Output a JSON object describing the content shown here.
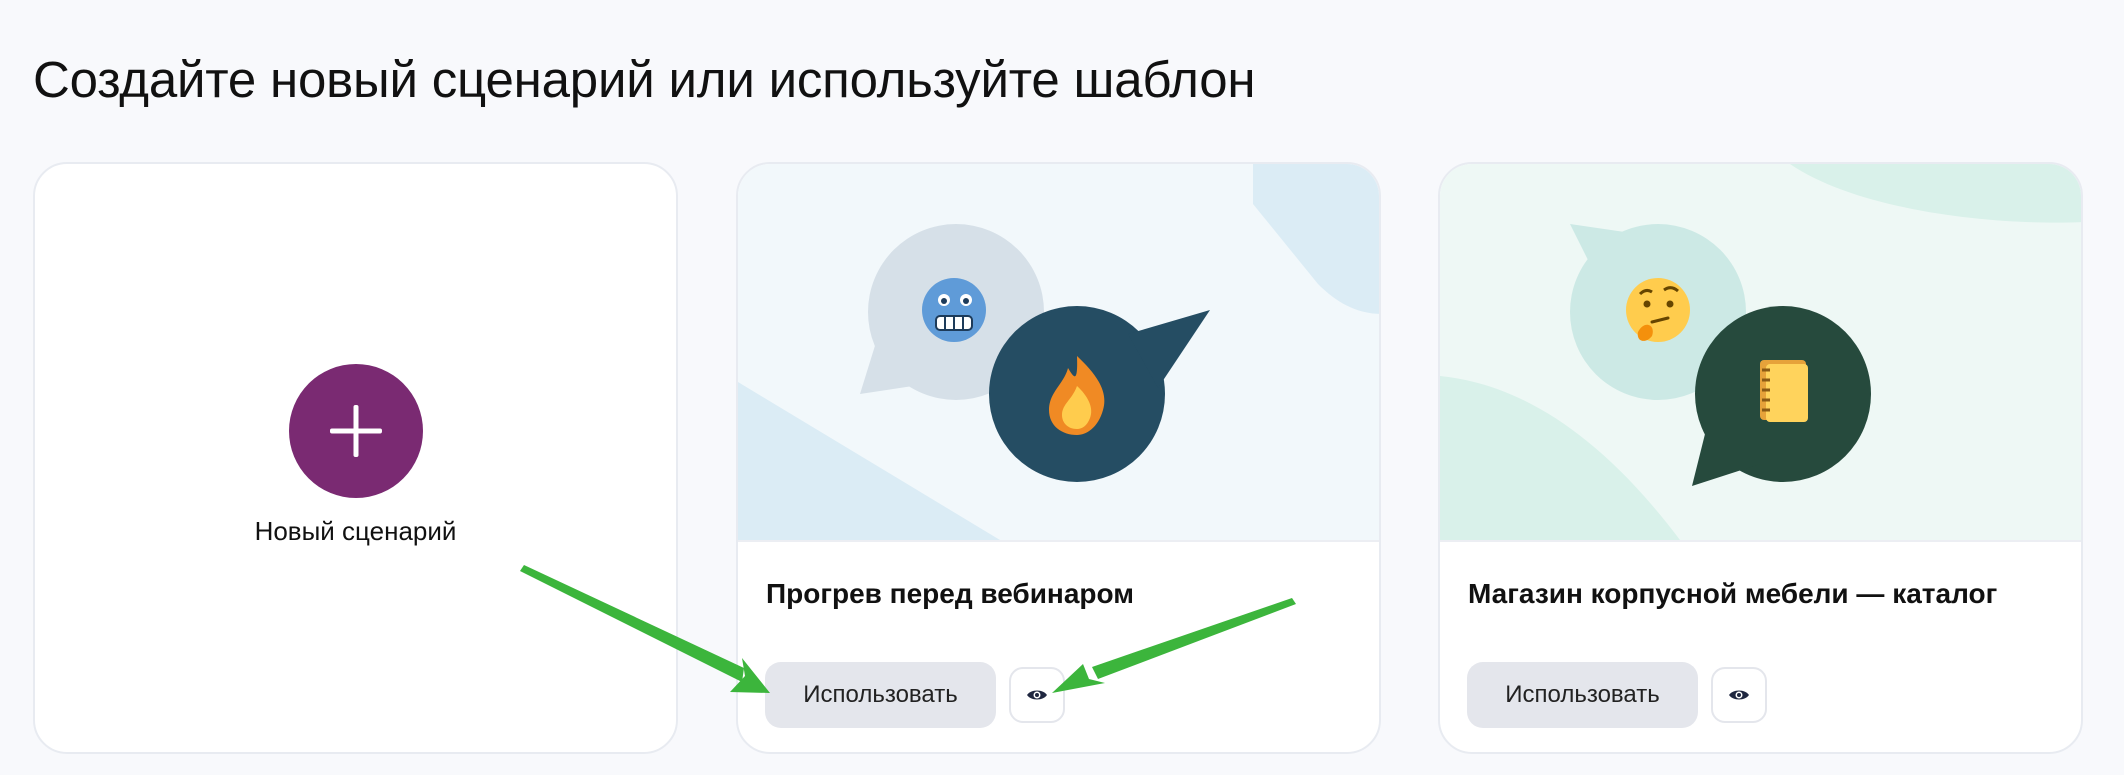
{
  "page": {
    "title": "Создайте новый сценарий или используйте шаблон"
  },
  "new_card": {
    "label": "Новый сценарий",
    "icon": "plus-icon",
    "accent": "#7a2a72"
  },
  "templates": [
    {
      "title": "Прогрев перед вебинаром",
      "use_label": "Использовать",
      "preview_icon": "eye-icon",
      "emojis": [
        "cold-face-icon",
        "fire-icon"
      ],
      "bg_color": "#f2f8fb"
    },
    {
      "title": "Магазин корпусной мебели — каталог",
      "use_label": "Использовать",
      "preview_icon": "eye-icon",
      "emojis": [
        "thinking-face-icon",
        "notebook-icon"
      ],
      "bg_color": "#eef8f5"
    }
  ],
  "annotations": {
    "arrow_color": "#3cb53c"
  }
}
